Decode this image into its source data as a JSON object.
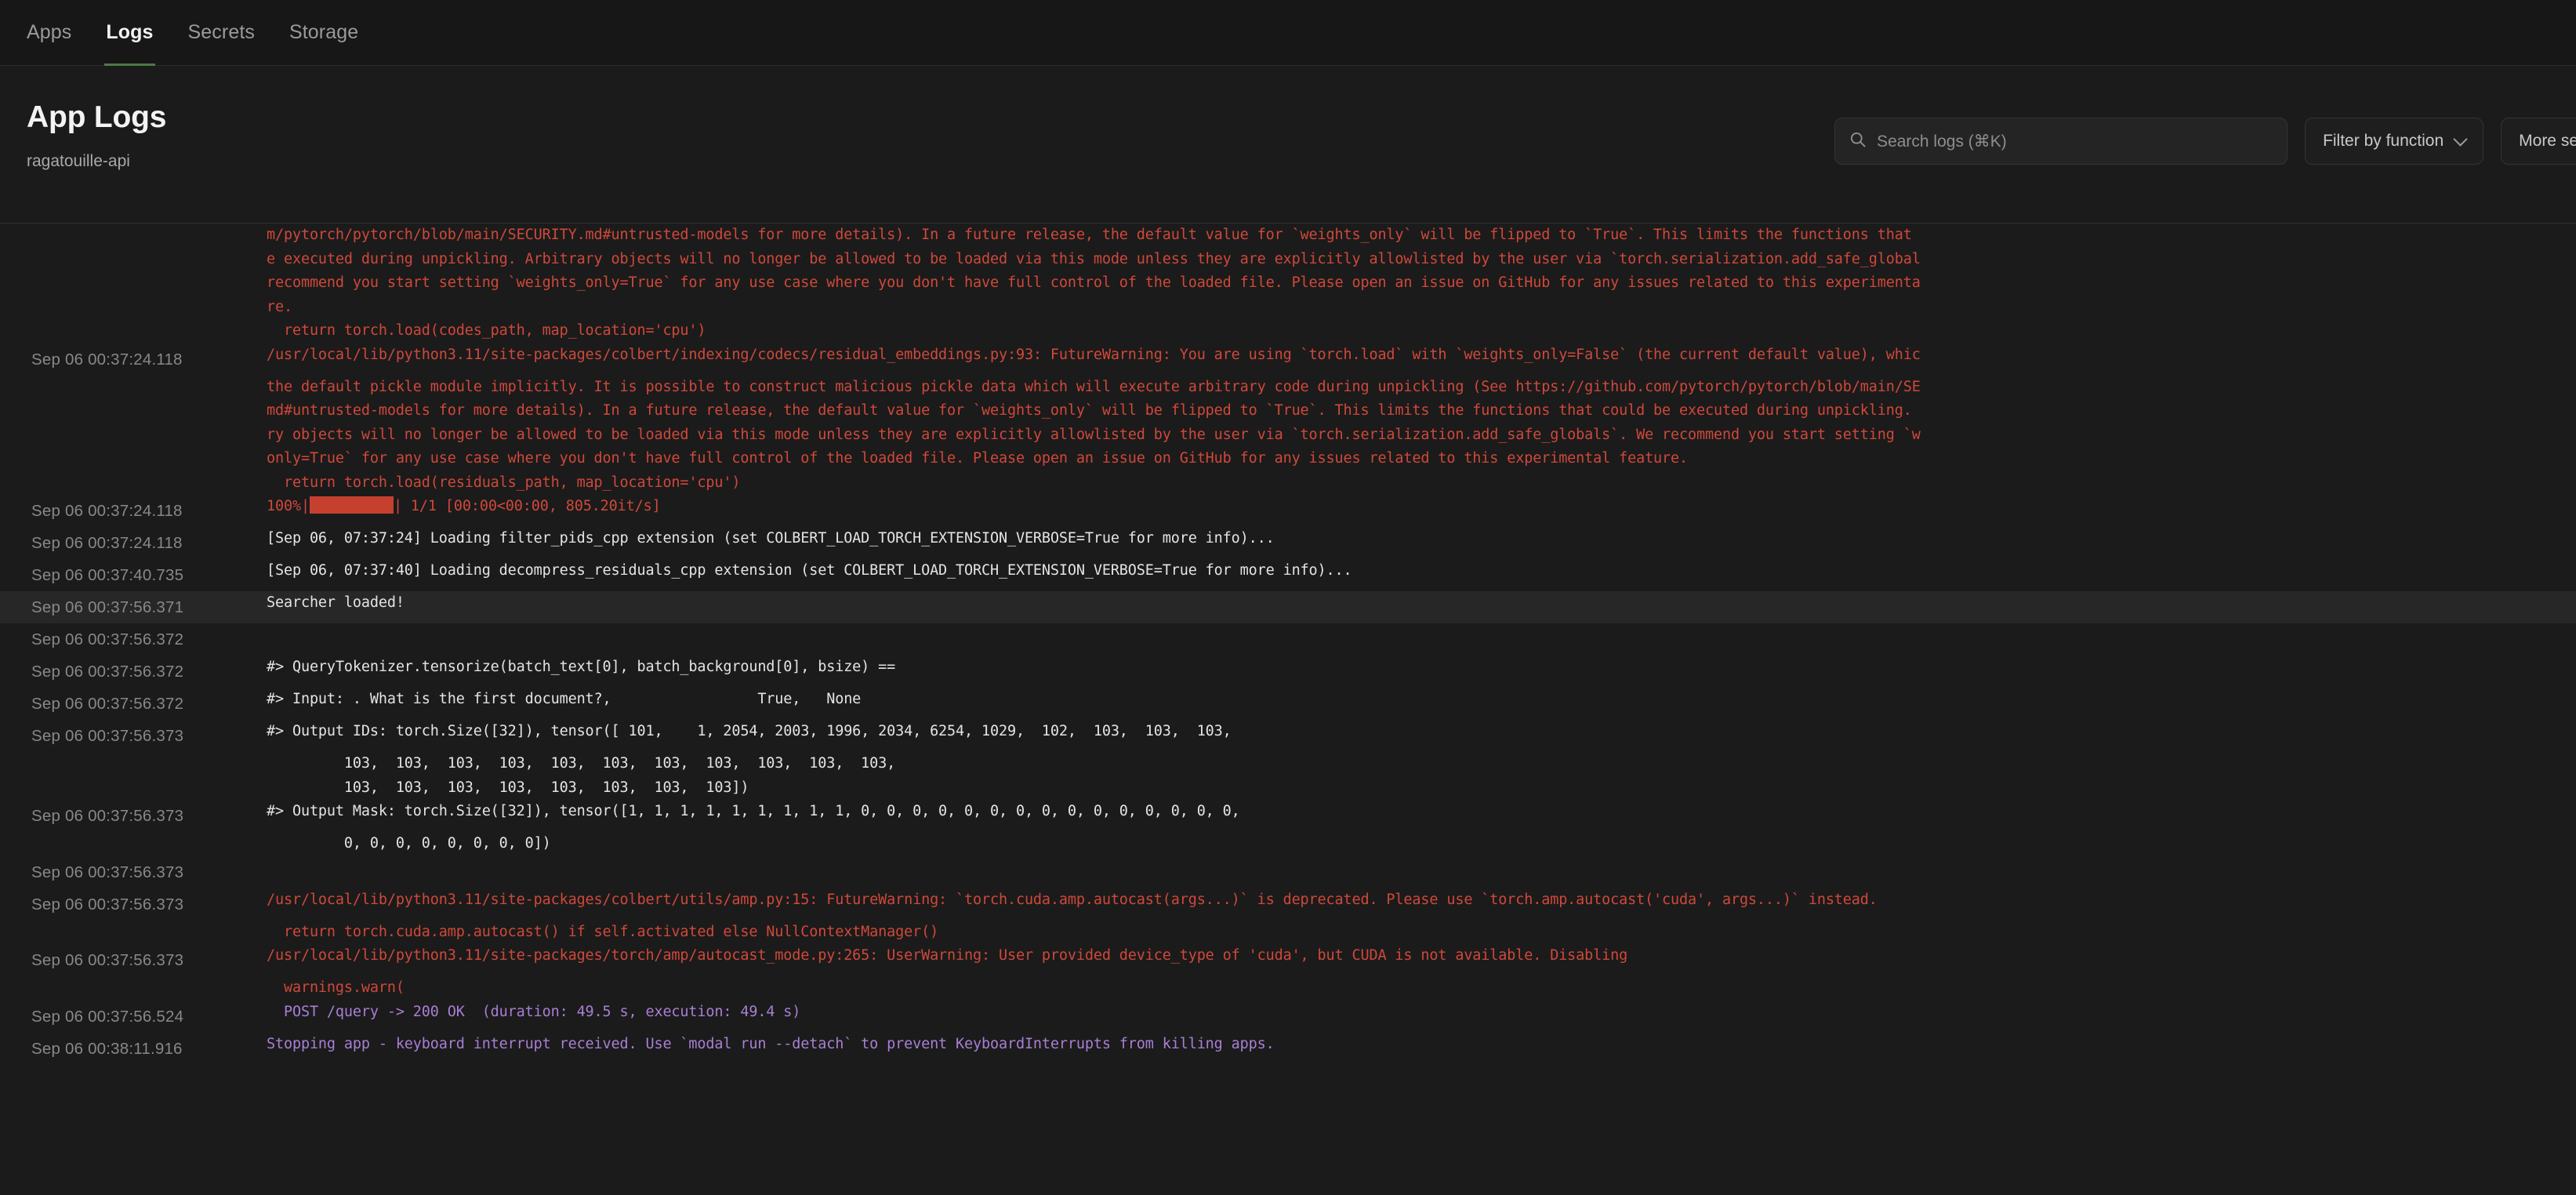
{
  "nav": {
    "tabs": [
      {
        "label": "Apps",
        "active": false
      },
      {
        "label": "Logs",
        "active": true
      },
      {
        "label": "Secrets",
        "active": false
      },
      {
        "label": "Storage",
        "active": false
      }
    ]
  },
  "header": {
    "title": "App Logs",
    "app_name": "ragatouille-api"
  },
  "search": {
    "placeholder": "Search logs (⌘K)",
    "value": "",
    "icon": "search-icon"
  },
  "controls": {
    "filter_label": "Filter by function",
    "filter_icon": "chevron-down-icon",
    "more_label": "More se"
  },
  "colors": {
    "accent_green": "#4e7a45",
    "stderr_red": "#d0483a",
    "stdout_white": "#e4e4e4",
    "system_purple": "#a87fd4",
    "timestamp_gray": "#888888",
    "page_bg": "#1b1b1b",
    "nav_bg": "#171717",
    "highlight_row_bg": "#272727",
    "progress_bar": "#c6402f"
  },
  "log": {
    "lines": [
      {
        "ts": "",
        "stream": "err",
        "text": "m/pytorch/pytorch/blob/main/SECURITY.md#untrusted-models for more details). In a future release, the default value for `weights_only` will be flipped to `True`. This limits the functions that",
        "cont": true
      },
      {
        "ts": "",
        "stream": "err",
        "text": "e executed during unpickling. Arbitrary objects will no longer be allowed to be loaded via this mode unless they are explicitly allowlisted by the user via `torch.serialization.add_safe_global",
        "cont": true
      },
      {
        "ts": "",
        "stream": "err",
        "text": "recommend you start setting `weights_only=True` for any use case where you don't have full control of the loaded file. Please open an issue on GitHub for any issues related to this experimenta",
        "cont": true
      },
      {
        "ts": "",
        "stream": "err",
        "text": "re.",
        "cont": true
      },
      {
        "ts": "",
        "stream": "err",
        "text": "  return torch.load(codes_path, map_location='cpu')",
        "cont": true
      },
      {
        "ts": "Sep 06 00:37:24.118",
        "stream": "err",
        "text": "/usr/local/lib/python3.11/site-packages/colbert/indexing/codecs/residual_embeddings.py:93: FutureWarning: You are using `torch.load` with `weights_only=False` (the current default value), whic",
        "cont": false
      },
      {
        "ts": "",
        "stream": "err",
        "text": "the default pickle module implicitly. It is possible to construct malicious pickle data which will execute arbitrary code during unpickling (See https://github.com/pytorch/pytorch/blob/main/SE",
        "cont": true
      },
      {
        "ts": "",
        "stream": "err",
        "text": "md#untrusted-models for more details). In a future release, the default value for `weights_only` will be flipped to `True`. This limits the functions that could be executed during unpickling.",
        "cont": true
      },
      {
        "ts": "",
        "stream": "err",
        "text": "ry objects will no longer be allowed to be loaded via this mode unless they are explicitly allowlisted by the user via `torch.serialization.add_safe_globals`. We recommend you start setting `w",
        "cont": true
      },
      {
        "ts": "",
        "stream": "err",
        "text": "only=True` for any use case where you don't have full control of the loaded file. Please open an issue on GitHub for any issues related to this experimental feature.",
        "cont": true
      },
      {
        "ts": "",
        "stream": "err",
        "text": "  return torch.load(residuals_path, map_location='cpu')",
        "cont": true
      },
      {
        "ts": "Sep 06 00:37:24.118",
        "stream": "err",
        "text": "100%|@@PBAR@@| 1/1 [00:00<00:00, 805.20it/s]",
        "cont": false
      },
      {
        "ts": "Sep 06 00:37:24.118",
        "stream": "out",
        "text": "[Sep 06, 07:37:24] Loading filter_pids_cpp extension (set COLBERT_LOAD_TORCH_EXTENSION_VERBOSE=True for more info)...",
        "cont": false
      },
      {
        "ts": "Sep 06 00:37:40.735",
        "stream": "out",
        "text": "[Sep 06, 07:37:40] Loading decompress_residuals_cpp extension (set COLBERT_LOAD_TORCH_EXTENSION_VERBOSE=True for more info)...",
        "cont": false
      },
      {
        "ts": "Sep 06 00:37:56.371",
        "stream": "out",
        "text": "Searcher loaded!",
        "cont": false,
        "highlight": true
      },
      {
        "ts": "Sep 06 00:37:56.372",
        "stream": "out",
        "text": "",
        "cont": false
      },
      {
        "ts": "Sep 06 00:37:56.372",
        "stream": "out",
        "text": "#> QueryTokenizer.tensorize(batch_text[0], batch_background[0], bsize) ==",
        "cont": false
      },
      {
        "ts": "Sep 06 00:37:56.372",
        "stream": "out",
        "text": "#> Input: . What is the first document?, \t\t True, \t None",
        "cont": false
      },
      {
        "ts": "Sep 06 00:37:56.373",
        "stream": "out",
        "text": "#> Output IDs: torch.Size([32]), tensor([ 101,    1, 2054, 2003, 1996, 2034, 6254, 1029,  102,  103,  103,  103,",
        "cont": false
      },
      {
        "ts": "",
        "stream": "out",
        "text": "         103,  103,  103,  103,  103,  103,  103,  103,  103,  103,  103,",
        "cont": true
      },
      {
        "ts": "",
        "stream": "out",
        "text": "         103,  103,  103,  103,  103,  103,  103,  103])",
        "cont": true
      },
      {
        "ts": "Sep 06 00:37:56.373",
        "stream": "out",
        "text": "#> Output Mask: torch.Size([32]), tensor([1, 1, 1, 1, 1, 1, 1, 1, 1, 0, 0, 0, 0, 0, 0, 0, 0, 0, 0, 0, 0, 0, 0, 0,",
        "cont": false
      },
      {
        "ts": "",
        "stream": "out",
        "text": "         0, 0, 0, 0, 0, 0, 0, 0])",
        "cont": true
      },
      {
        "ts": "Sep 06 00:37:56.373",
        "stream": "out",
        "text": "",
        "cont": false
      },
      {
        "ts": "Sep 06 00:37:56.373",
        "stream": "err",
        "text": "/usr/local/lib/python3.11/site-packages/colbert/utils/amp.py:15: FutureWarning: `torch.cuda.amp.autocast(args...)` is deprecated. Please use `torch.amp.autocast('cuda', args...)` instead.",
        "cont": false
      },
      {
        "ts": "",
        "stream": "err",
        "text": "  return torch.cuda.amp.autocast() if self.activated else NullContextManager()",
        "cont": true
      },
      {
        "ts": "Sep 06 00:37:56.373",
        "stream": "err",
        "text": "/usr/local/lib/python3.11/site-packages/torch/amp/autocast_mode.py:265: UserWarning: User provided device_type of 'cuda', but CUDA is not available. Disabling",
        "cont": false
      },
      {
        "ts": "",
        "stream": "err",
        "text": "  warnings.warn(",
        "cont": true
      },
      {
        "ts": "Sep 06 00:37:56.524",
        "stream": "sys",
        "text": "  POST /query -> 200 OK  (duration: 49.5 s, execution: 49.4 s)",
        "cont": false
      },
      {
        "ts": "Sep 06 00:38:11.916",
        "stream": "sys",
        "text": "Stopping app - keyboard interrupt received. Use `modal run --detach` to prevent KeyboardInterrupts from killing apps.",
        "cont": false
      }
    ]
  }
}
